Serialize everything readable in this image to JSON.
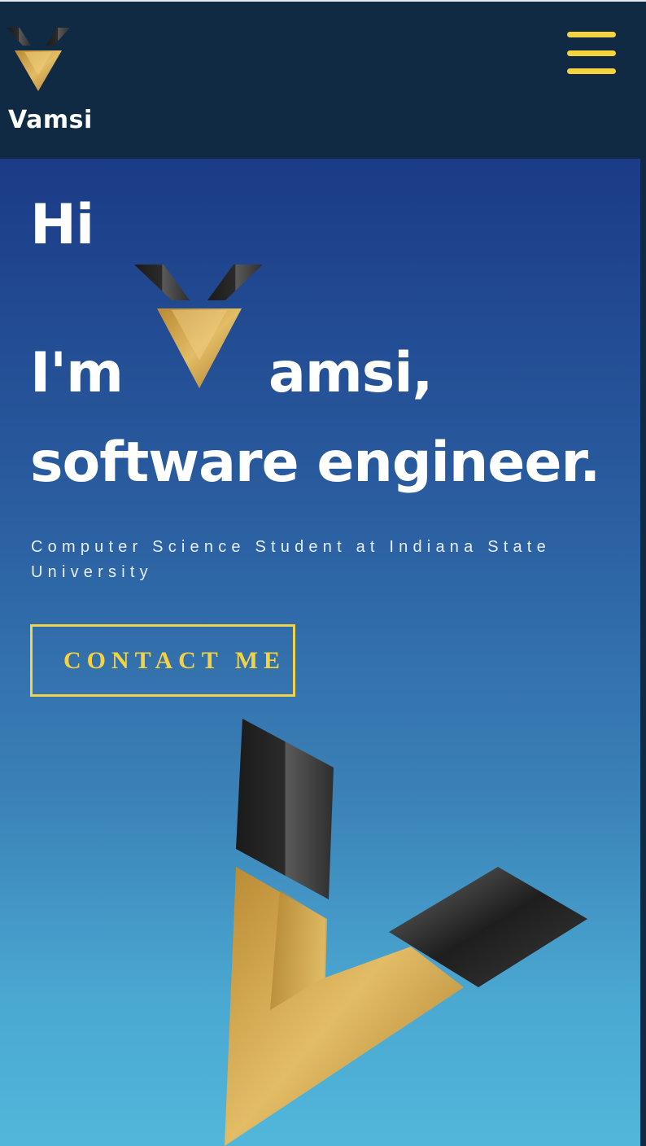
{
  "header": {
    "brand_name": "Vamsi",
    "logo_icon": "v-logo-icon",
    "menu_icon": "hamburger-menu-icon"
  },
  "hero": {
    "greeting": "Hi",
    "intro_prefix": "I'm",
    "intro_name_suffix": "amsi,",
    "role": "software engineer.",
    "subtitle": "Computer Science Student at Indiana State University",
    "contact_button_label": "CONTACT ME"
  },
  "colors": {
    "accent": "#f5d33f",
    "header_bg": "#102a43",
    "gold": "#d4a94a",
    "gradient_top": "#1b3b86",
    "gradient_bottom": "#52b6da"
  }
}
